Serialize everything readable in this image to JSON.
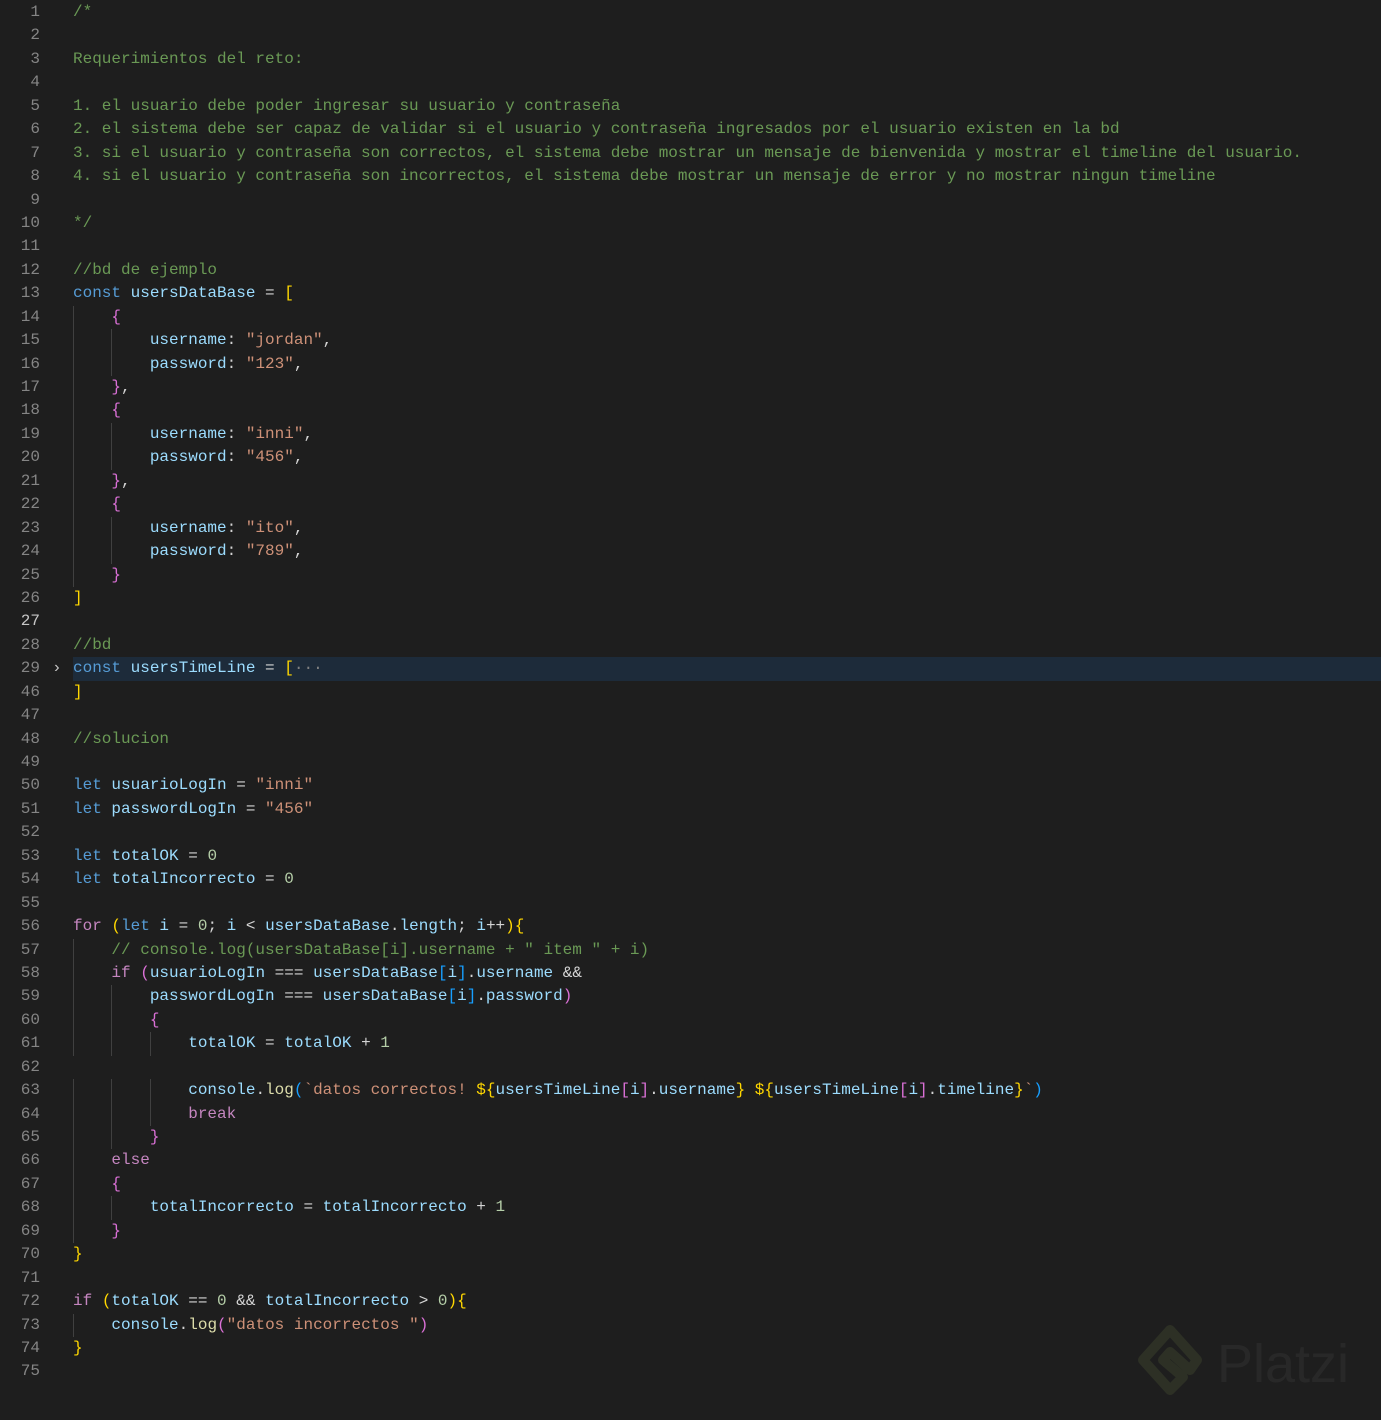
{
  "colors": {
    "background": "#1e1e1e",
    "comment": "#6a9955",
    "keyword": "#569cd6",
    "variable": "#9cdcfe",
    "string": "#ce9178"
  },
  "watermark": "Platzi",
  "current_line": "27",
  "lines": [
    {
      "n": "1",
      "t": [
        [
          "c",
          "/*"
        ]
      ]
    },
    {
      "n": "2",
      "t": []
    },
    {
      "n": "3",
      "t": [
        [
          "c",
          "Requerimientos del reto:"
        ]
      ]
    },
    {
      "n": "4",
      "t": []
    },
    {
      "n": "5",
      "t": [
        [
          "c",
          "1. el usuario debe poder ingresar su usuario y contraseña"
        ]
      ]
    },
    {
      "n": "6",
      "t": [
        [
          "c",
          "2. el sistema debe ser capaz de validar si el usuario y contraseña ingresados por el usuario existen en la bd"
        ]
      ]
    },
    {
      "n": "7",
      "t": [
        [
          "c",
          "3. si el usuario y contraseña son correctos, el sistema debe mostrar un mensaje de bienvenida y mostrar el timeline del usuario."
        ]
      ]
    },
    {
      "n": "8",
      "t": [
        [
          "c",
          "4. si el usuario y contraseña son incorrectos, el sistema debe mostrar un mensaje de error y no mostrar ningun timeline"
        ]
      ]
    },
    {
      "n": "9",
      "t": []
    },
    {
      "n": "10",
      "t": [
        [
          "c",
          "*/"
        ]
      ]
    },
    {
      "n": "11",
      "t": []
    },
    {
      "n": "12",
      "t": [
        [
          "c",
          "//bd de ejemplo"
        ]
      ]
    },
    {
      "n": "13",
      "t": [
        [
          "k",
          "const "
        ],
        [
          "v",
          "usersDataBase"
        ],
        [
          "p",
          " = "
        ],
        [
          "b1",
          "["
        ]
      ]
    },
    {
      "n": "14",
      "g": 1,
      "t": [
        [
          "p",
          "    "
        ],
        [
          "b2",
          "{"
        ]
      ]
    },
    {
      "n": "15",
      "g": 2,
      "t": [
        [
          "p",
          "        "
        ],
        [
          "v",
          "username"
        ],
        [
          "p",
          ": "
        ],
        [
          "s",
          "\"jordan\""
        ],
        [
          "p",
          ","
        ]
      ]
    },
    {
      "n": "16",
      "g": 2,
      "t": [
        [
          "p",
          "        "
        ],
        [
          "v",
          "password"
        ],
        [
          "p",
          ": "
        ],
        [
          "s",
          "\"123\""
        ],
        [
          "p",
          ","
        ]
      ]
    },
    {
      "n": "17",
      "g": 1,
      "t": [
        [
          "p",
          "    "
        ],
        [
          "b2",
          "}"
        ],
        [
          "p",
          ","
        ]
      ]
    },
    {
      "n": "18",
      "g": 1,
      "t": [
        [
          "p",
          "    "
        ],
        [
          "b2",
          "{"
        ]
      ]
    },
    {
      "n": "19",
      "g": 2,
      "t": [
        [
          "p",
          "        "
        ],
        [
          "v",
          "username"
        ],
        [
          "p",
          ": "
        ],
        [
          "s",
          "\"inni\""
        ],
        [
          "p",
          ","
        ]
      ]
    },
    {
      "n": "20",
      "g": 2,
      "t": [
        [
          "p",
          "        "
        ],
        [
          "v",
          "password"
        ],
        [
          "p",
          ": "
        ],
        [
          "s",
          "\"456\""
        ],
        [
          "p",
          ","
        ]
      ]
    },
    {
      "n": "21",
      "g": 1,
      "t": [
        [
          "p",
          "    "
        ],
        [
          "b2",
          "}"
        ],
        [
          "p",
          ","
        ]
      ]
    },
    {
      "n": "22",
      "g": 1,
      "t": [
        [
          "p",
          "    "
        ],
        [
          "b2",
          "{"
        ]
      ]
    },
    {
      "n": "23",
      "g": 2,
      "t": [
        [
          "p",
          "        "
        ],
        [
          "v",
          "username"
        ],
        [
          "p",
          ": "
        ],
        [
          "s",
          "\"ito\""
        ],
        [
          "p",
          ","
        ]
      ]
    },
    {
      "n": "24",
      "g": 2,
      "t": [
        [
          "p",
          "        "
        ],
        [
          "v",
          "password"
        ],
        [
          "p",
          ": "
        ],
        [
          "s",
          "\"789\""
        ],
        [
          "p",
          ","
        ]
      ]
    },
    {
      "n": "25",
      "g": 1,
      "t": [
        [
          "p",
          "    "
        ],
        [
          "b2",
          "}"
        ]
      ]
    },
    {
      "n": "26",
      "t": [
        [
          "b1",
          "]"
        ]
      ]
    },
    {
      "n": "27",
      "cur": true,
      "t": []
    },
    {
      "n": "28",
      "t": [
        [
          "c",
          "//bd"
        ]
      ]
    },
    {
      "n": "29",
      "hl": true,
      "fold": "›",
      "t": [
        [
          "k",
          "const "
        ],
        [
          "v",
          "usersTimeLine"
        ],
        [
          "p",
          " = "
        ],
        [
          "b1",
          "["
        ],
        [
          "e",
          "···"
        ]
      ]
    },
    {
      "n": "46",
      "t": [
        [
          "b1",
          "]"
        ]
      ]
    },
    {
      "n": "47",
      "t": []
    },
    {
      "n": "48",
      "t": [
        [
          "c",
          "//solucion"
        ]
      ]
    },
    {
      "n": "49",
      "t": []
    },
    {
      "n": "50",
      "t": [
        [
          "k",
          "let "
        ],
        [
          "v",
          "usuarioLogIn"
        ],
        [
          "p",
          " = "
        ],
        [
          "s",
          "\"inni\""
        ]
      ]
    },
    {
      "n": "51",
      "t": [
        [
          "k",
          "let "
        ],
        [
          "v",
          "passwordLogIn"
        ],
        [
          "p",
          " = "
        ],
        [
          "s",
          "\"456\""
        ]
      ]
    },
    {
      "n": "52",
      "t": []
    },
    {
      "n": "53",
      "t": [
        [
          "k",
          "let "
        ],
        [
          "v",
          "totalOK"
        ],
        [
          "p",
          " = "
        ],
        [
          "n",
          "0"
        ]
      ]
    },
    {
      "n": "54",
      "t": [
        [
          "k",
          "let "
        ],
        [
          "v",
          "totalIncorrecto"
        ],
        [
          "p",
          " = "
        ],
        [
          "n",
          "0"
        ]
      ]
    },
    {
      "n": "55",
      "t": []
    },
    {
      "n": "56",
      "t": [
        [
          "x",
          "for "
        ],
        [
          "b1",
          "("
        ],
        [
          "k",
          "let "
        ],
        [
          "v",
          "i"
        ],
        [
          "p",
          " = "
        ],
        [
          "n",
          "0"
        ],
        [
          "p",
          "; "
        ],
        [
          "v",
          "i"
        ],
        [
          "p",
          " < "
        ],
        [
          "v",
          "usersDataBase"
        ],
        [
          "p",
          "."
        ],
        [
          "v",
          "length"
        ],
        [
          "p",
          "; "
        ],
        [
          "v",
          "i"
        ],
        [
          "p",
          "++"
        ],
        [
          "b1",
          ")"
        ],
        [
          "b1",
          "{"
        ]
      ]
    },
    {
      "n": "57",
      "g": 1,
      "t": [
        [
          "p",
          "    "
        ],
        [
          "c",
          "// console.log(usersDataBase[i].username + \" item \" + i)"
        ]
      ]
    },
    {
      "n": "58",
      "g": 1,
      "t": [
        [
          "p",
          "    "
        ],
        [
          "x",
          "if "
        ],
        [
          "b2",
          "("
        ],
        [
          "v",
          "usuarioLogIn"
        ],
        [
          "p",
          " === "
        ],
        [
          "v",
          "usersDataBase"
        ],
        [
          "b3",
          "["
        ],
        [
          "v",
          "i"
        ],
        [
          "b3",
          "]"
        ],
        [
          "p",
          "."
        ],
        [
          "v",
          "username"
        ],
        [
          "p",
          " &&"
        ]
      ]
    },
    {
      "n": "59",
      "g": 2,
      "t": [
        [
          "p",
          "        "
        ],
        [
          "v",
          "passwordLogIn"
        ],
        [
          "p",
          " === "
        ],
        [
          "v",
          "usersDataBase"
        ],
        [
          "b3",
          "["
        ],
        [
          "v",
          "i"
        ],
        [
          "b3",
          "]"
        ],
        [
          "p",
          "."
        ],
        [
          "v",
          "password"
        ],
        [
          "b2",
          ")"
        ]
      ]
    },
    {
      "n": "60",
      "g": 2,
      "t": [
        [
          "p",
          "        "
        ],
        [
          "b2",
          "{"
        ]
      ]
    },
    {
      "n": "61",
      "g": 3,
      "t": [
        [
          "p",
          "            "
        ],
        [
          "v",
          "totalOK"
        ],
        [
          "p",
          " = "
        ],
        [
          "v",
          "totalOK"
        ],
        [
          "p",
          " + "
        ],
        [
          "n",
          "1"
        ]
      ]
    },
    {
      "n": "62",
      "g": 3,
      "t": []
    },
    {
      "n": "63",
      "g": 3,
      "t": [
        [
          "p",
          "            "
        ],
        [
          "v",
          "console"
        ],
        [
          "p",
          "."
        ],
        [
          "f",
          "log"
        ],
        [
          "b3",
          "("
        ],
        [
          "s",
          "`datos correctos! "
        ],
        [
          "b1",
          "${"
        ],
        [
          "v",
          "usersTimeLine"
        ],
        [
          "b2",
          "["
        ],
        [
          "v",
          "i"
        ],
        [
          "b2",
          "]"
        ],
        [
          "p",
          "."
        ],
        [
          "v",
          "username"
        ],
        [
          "b1",
          "}"
        ],
        [
          "s",
          " "
        ],
        [
          "b1",
          "${"
        ],
        [
          "v",
          "usersTimeLine"
        ],
        [
          "b2",
          "["
        ],
        [
          "v",
          "i"
        ],
        [
          "b2",
          "]"
        ],
        [
          "p",
          "."
        ],
        [
          "v",
          "timeline"
        ],
        [
          "b1",
          "}"
        ],
        [
          "s",
          "`"
        ],
        [
          "b3",
          ")"
        ]
      ]
    },
    {
      "n": "64",
      "g": 3,
      "t": [
        [
          "p",
          "            "
        ],
        [
          "x",
          "break"
        ]
      ]
    },
    {
      "n": "65",
      "g": 2,
      "t": [
        [
          "p",
          "        "
        ],
        [
          "b2",
          "}"
        ]
      ]
    },
    {
      "n": "66",
      "g": 1,
      "t": [
        [
          "p",
          "    "
        ],
        [
          "x",
          "else"
        ]
      ]
    },
    {
      "n": "67",
      "g": 1,
      "t": [
        [
          "p",
          "    "
        ],
        [
          "b2",
          "{"
        ]
      ]
    },
    {
      "n": "68",
      "g": 2,
      "t": [
        [
          "p",
          "        "
        ],
        [
          "v",
          "totalIncorrecto"
        ],
        [
          "p",
          " = "
        ],
        [
          "v",
          "totalIncorrecto"
        ],
        [
          "p",
          " + "
        ],
        [
          "n",
          "1"
        ]
      ]
    },
    {
      "n": "69",
      "g": 1,
      "t": [
        [
          "p",
          "    "
        ],
        [
          "b2",
          "}"
        ]
      ]
    },
    {
      "n": "70",
      "t": [
        [
          "b1",
          "}"
        ]
      ]
    },
    {
      "n": "71",
      "t": []
    },
    {
      "n": "72",
      "t": [
        [
          "x",
          "if "
        ],
        [
          "b1",
          "("
        ],
        [
          "v",
          "totalOK"
        ],
        [
          "p",
          " == "
        ],
        [
          "n",
          "0"
        ],
        [
          "p",
          " && "
        ],
        [
          "v",
          "totalIncorrecto"
        ],
        [
          "p",
          " > "
        ],
        [
          "n",
          "0"
        ],
        [
          "b1",
          ")"
        ],
        [
          "b1",
          "{"
        ]
      ]
    },
    {
      "n": "73",
      "g": 1,
      "t": [
        [
          "p",
          "    "
        ],
        [
          "v",
          "console"
        ],
        [
          "p",
          "."
        ],
        [
          "f",
          "log"
        ],
        [
          "b2",
          "("
        ],
        [
          "s",
          "\"datos incorrectos \""
        ],
        [
          "b2",
          ")"
        ]
      ]
    },
    {
      "n": "74",
      "t": [
        [
          "b1",
          "}"
        ]
      ]
    },
    {
      "n": "75",
      "t": []
    }
  ]
}
